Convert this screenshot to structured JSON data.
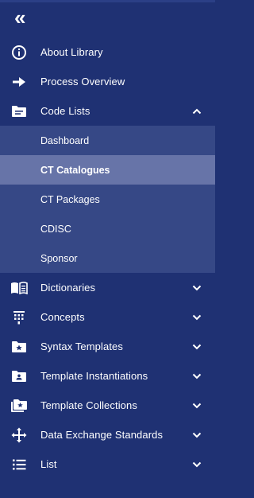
{
  "sidebar": {
    "collapse_glyph": "«",
    "top_items": [
      {
        "label": "About Library",
        "icon": "info-circle-icon"
      },
      {
        "label": "Process Overview",
        "icon": "arrow-right-icon"
      },
      {
        "label": "Code Lists",
        "icon": "folder-list-icon",
        "expanded": true
      }
    ],
    "code_lists_sub": [
      {
        "label": "Dashboard"
      },
      {
        "label": "CT Catalogues",
        "active": true
      },
      {
        "label": "CT Packages"
      },
      {
        "label": "CDISC"
      },
      {
        "label": "Sponsor"
      }
    ],
    "bottom_items": [
      {
        "label": "Dictionaries",
        "icon": "book-icon"
      },
      {
        "label": "Concepts",
        "icon": "concepts-icon"
      },
      {
        "label": "Syntax Templates",
        "icon": "folder-star-icon"
      },
      {
        "label": "Template Instantiations",
        "icon": "folder-account-icon"
      },
      {
        "label": "Template Collections",
        "icon": "folder-multiple-star-icon"
      },
      {
        "label": "Data Exchange Standards",
        "icon": "arrows-all-icon"
      },
      {
        "label": "List",
        "icon": "list-icon"
      }
    ]
  },
  "colors": {
    "sidebar_bg": "#1f3173",
    "submenu_bg": "#364886",
    "active_bg": "#6774a8",
    "text": "#ffffff"
  }
}
